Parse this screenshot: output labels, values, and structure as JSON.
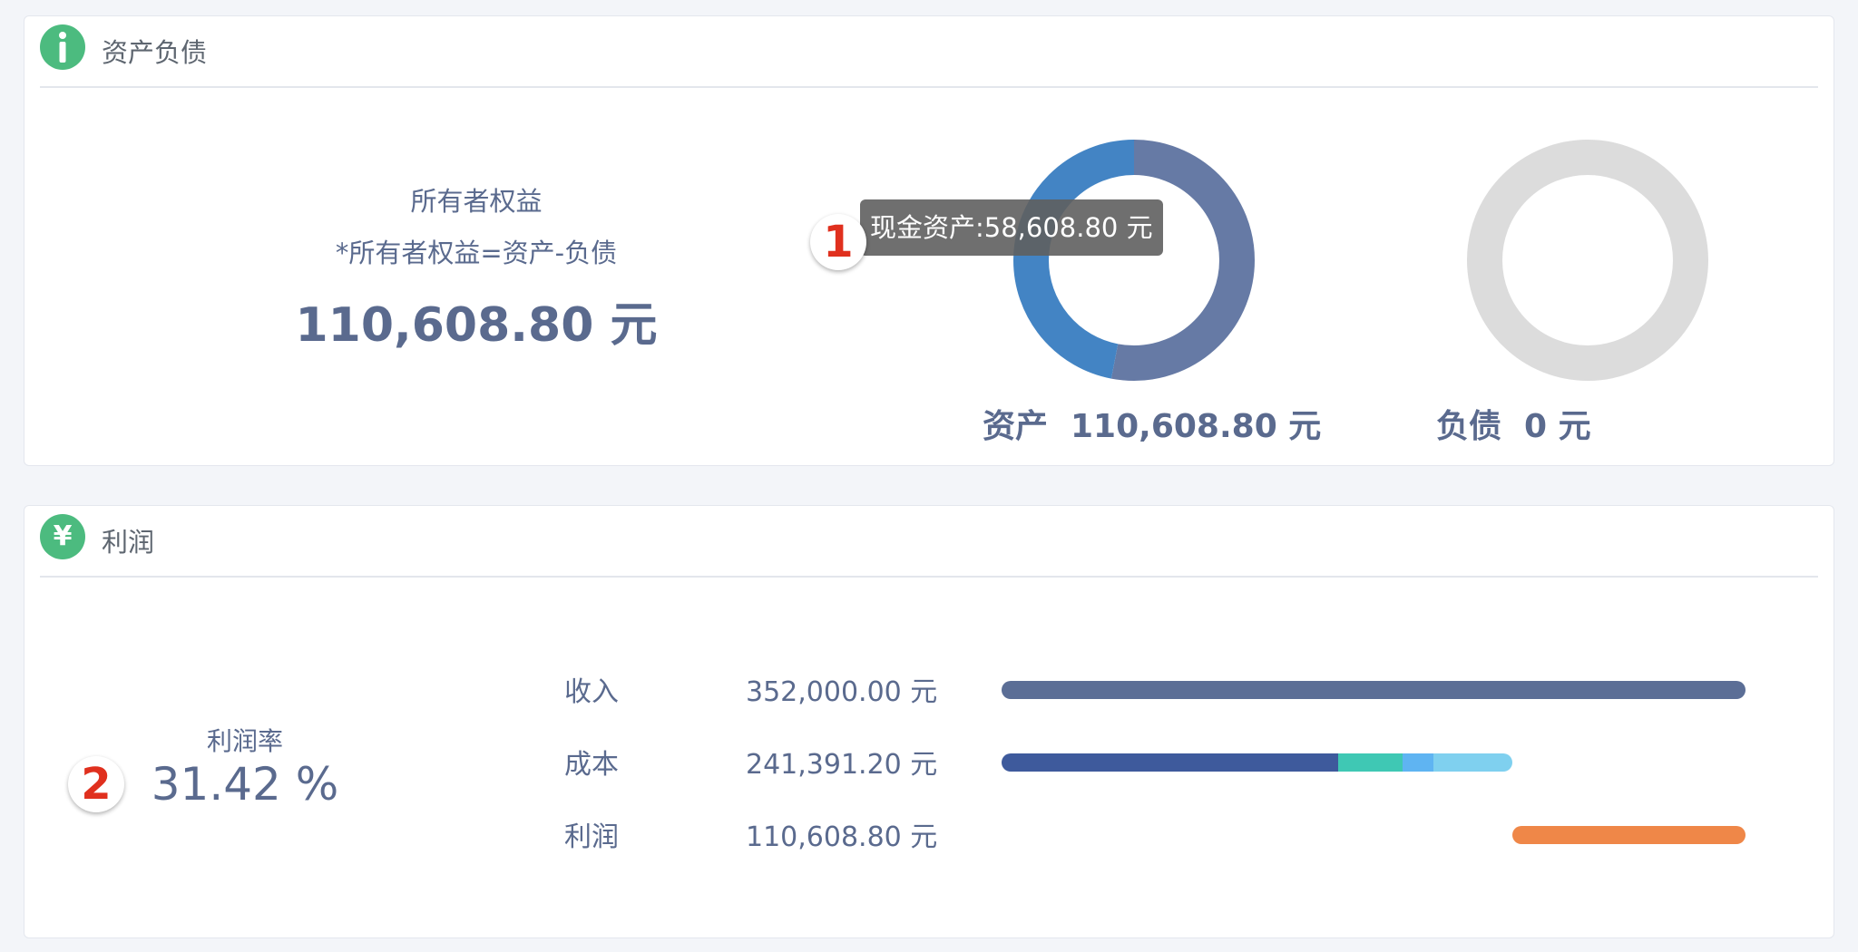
{
  "assets_panel": {
    "title": "资产负债",
    "header_icon": "info-icon",
    "equity": {
      "title": "所有者权益",
      "formula": "*所有者权益=资产-负债",
      "value": "110,608.80 元"
    },
    "assets": {
      "label": "资产",
      "value": "110,608.80 元",
      "chart_fraction_segments": [
        {
          "name": "cash",
          "fraction": 0.53,
          "color": "#667aa5"
        },
        {
          "name": "other",
          "fraction": 0.47,
          "color": "#4384c4"
        }
      ]
    },
    "liabilities": {
      "label": "负债",
      "value": "0 元",
      "empty_color": "#dcdcdc"
    },
    "tooltip": "现金资产:58,608.80 元",
    "marker": "1"
  },
  "profit_panel": {
    "title": "利润",
    "header_icon": "yen-icon",
    "header_icon_glyph": "¥",
    "rate_label": "利润率",
    "rate_value": "31.42 %",
    "marker": "2",
    "rows": [
      {
        "label": "收入",
        "value": "352,000.00 元"
      },
      {
        "label": "成本",
        "value": "241,391.20 元"
      },
      {
        "label": "利润",
        "value": "110,608.80 元"
      }
    ],
    "bars": {
      "income_fraction": 1.0,
      "cost_fraction": 0.686,
      "cost_segment_fractions": [
        0.659,
        0.127,
        0.061,
        0.153
      ],
      "profit_fraction": 0.314,
      "colors": {
        "income": "#5b6e96",
        "cost": [
          "#3e5a9c",
          "#3fc8b4",
          "#5fb4f2",
          "#7fd0ef"
        ],
        "profit": "#ef8748"
      }
    }
  }
}
